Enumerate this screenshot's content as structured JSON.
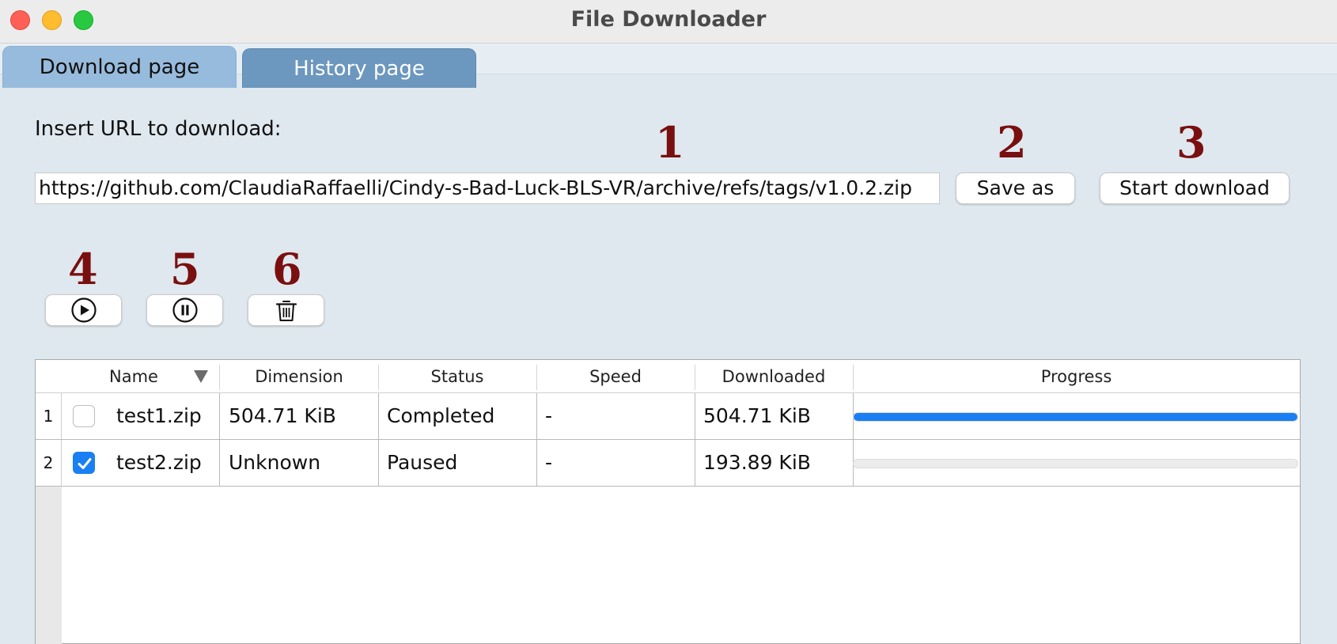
{
  "window": {
    "title": "File Downloader"
  },
  "tabs": [
    {
      "label": "Download page",
      "active": true
    },
    {
      "label": "History page",
      "active": false
    }
  ],
  "download": {
    "url_label": "Insert URL to download:",
    "url_value": "https://github.com/ClaudiaRaffaelli/Cindy-s-Bad-Luck-BLS-VR/archive/refs/tags/v1.0.2.zip",
    "save_as_label": "Save as",
    "start_download_label": "Start download"
  },
  "annotations": [
    "1",
    "2",
    "3",
    "4",
    "5",
    "6"
  ],
  "toolbar": {
    "play_icon": "play-circle-icon",
    "pause_icon": "pause-circle-icon",
    "delete_icon": "trash-icon"
  },
  "table": {
    "columns": [
      "Name",
      "Dimension",
      "Status",
      "Speed",
      "Downloaded",
      "Progress"
    ],
    "rows": [
      {
        "num": "1",
        "checked": false,
        "name": "test1.zip",
        "dimension": "504.71 KiB",
        "status": "Completed",
        "speed": "-",
        "downloaded": "504.71 KiB",
        "progress": 1.0
      },
      {
        "num": "2",
        "checked": true,
        "name": "test2.zip",
        "dimension": "Unknown",
        "status": "Paused",
        "speed": "-",
        "downloaded": "193.89 KiB",
        "progress": 0.0
      }
    ]
  },
  "colors": {
    "accent": "#1a7ff2",
    "annotation": "#7a0f0f",
    "tab_active": "#97bbdc",
    "tab_inactive": "#6c97be"
  }
}
